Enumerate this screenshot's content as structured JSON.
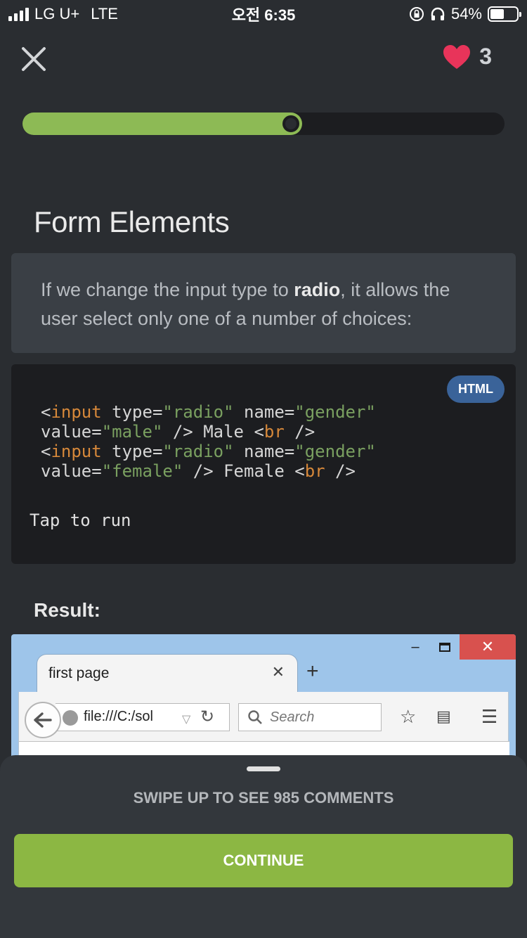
{
  "status_bar": {
    "carrier": "LG U+",
    "network": "LTE",
    "time": "오전 6:35",
    "battery": "54%",
    "battery_level": 0.54
  },
  "header": {
    "lives": "3"
  },
  "progress": {
    "fraction": 0.58
  },
  "lesson": {
    "title": "Form Elements",
    "desc_before": "If we change the input type to ",
    "desc_bold": "radio",
    "desc_after": ", it allows the user select only one of a number of choices:"
  },
  "code": {
    "language": "HTML",
    "lines": [
      [
        [
          "p",
          "<"
        ],
        [
          "t",
          "input"
        ],
        [
          "p",
          " type="
        ],
        [
          "s",
          "\"radio\""
        ],
        [
          "p",
          " name="
        ],
        [
          "s",
          "\"gender\""
        ]
      ],
      [
        [
          "p",
          "value="
        ],
        [
          "s",
          "\"male\""
        ],
        [
          "p",
          " /> Male <"
        ],
        [
          "t",
          "br"
        ],
        [
          "p",
          " />"
        ]
      ],
      [
        [
          "p",
          "<"
        ],
        [
          "t",
          "input"
        ],
        [
          "p",
          " type="
        ],
        [
          "s",
          "\"radio\""
        ],
        [
          "p",
          " name="
        ],
        [
          "s",
          "\"gender\""
        ]
      ],
      [
        [
          "p",
          "value="
        ],
        [
          "s",
          "\"female\""
        ],
        [
          "p",
          " /> Female <"
        ],
        [
          "t",
          "br"
        ],
        [
          "p",
          " />"
        ]
      ]
    ],
    "run_label": "Tap to run"
  },
  "result": {
    "label": "Result:",
    "tab_title": "first page",
    "url": "file:///C:/sol",
    "search_placeholder": "Search"
  },
  "sheet": {
    "swipe_text": "SWIPE UP TO SEE 985 COMMENTS",
    "continue_label": "CONTINUE"
  },
  "colors": {
    "accent_green": "#8cb743",
    "heart": "#e8345a",
    "badge": "#3a6399"
  }
}
